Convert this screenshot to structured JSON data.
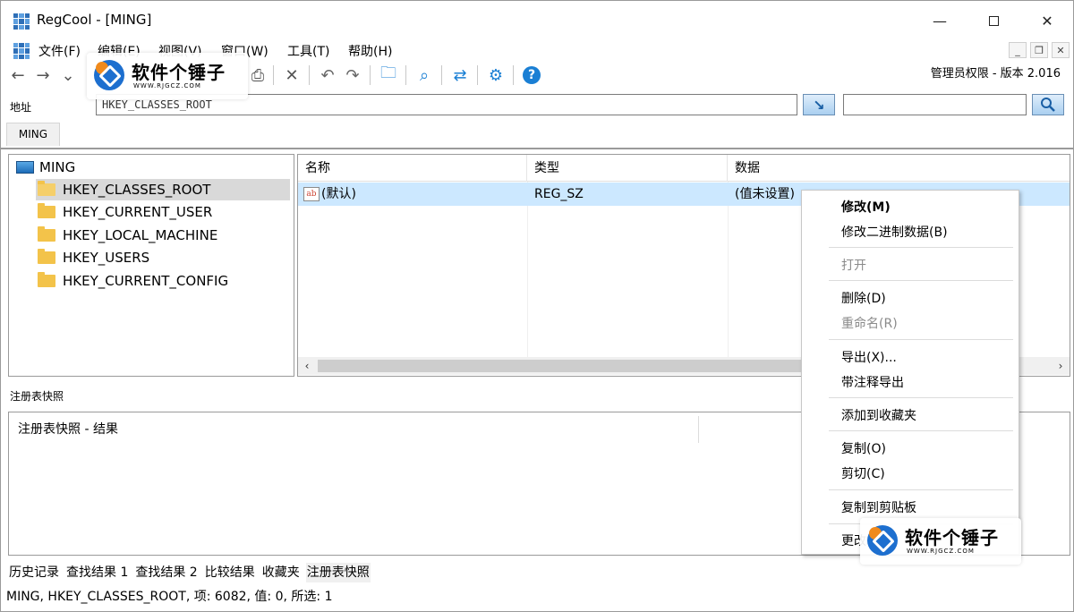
{
  "window": {
    "title": "RegCool - [MING]"
  },
  "menu": [
    "文件(F)",
    "编辑(E)",
    "视图(V)",
    "窗口(W)",
    "工具(T)",
    "帮助(H)"
  ],
  "version_text": "管理员权限 - 版本 2.016",
  "address": {
    "label": "地址",
    "value": "HKEY_CLASSES_ROOT"
  },
  "doc_tab": "MING",
  "tree": {
    "root": "MING",
    "children": [
      "HKEY_CLASSES_ROOT",
      "HKEY_CURRENT_USER",
      "HKEY_LOCAL_MACHINE",
      "HKEY_USERS",
      "HKEY_CURRENT_CONFIG"
    ],
    "selected_index": 0
  },
  "list": {
    "columns": [
      "名称",
      "类型",
      "数据"
    ],
    "rows": [
      {
        "name": "(默认)",
        "type": "REG_SZ",
        "data": "(值未设置)"
      }
    ]
  },
  "snapshot": {
    "title": "注册表快照",
    "result_label": "注册表快照 - 结果"
  },
  "bottom_tabs": [
    "历史记录",
    "查找结果 1",
    "查找结果 2",
    "比较结果",
    "收藏夹",
    "注册表快照"
  ],
  "bottom_tab_active": 5,
  "status": "MING, HKEY_CLASSES_ROOT, 项: 6082, 值: 0, 所选: 1",
  "context_menu": {
    "modify": "修改(M)",
    "modify_binary": "修改二进制数据(B)",
    "open": "打开",
    "delete": "删除(D)",
    "rename": "重命名(R)",
    "export": "导出(X)...",
    "export_comment": "带注释导出",
    "add_favorite": "添加到收藏夹",
    "copy": "复制(O)",
    "cut": "剪切(C)",
    "copy_clipboard": "复制到剪贴板",
    "more": "更改"
  },
  "watermark": {
    "title": "软件个锤子",
    "url": "WWW.RJGCZ.COM"
  }
}
